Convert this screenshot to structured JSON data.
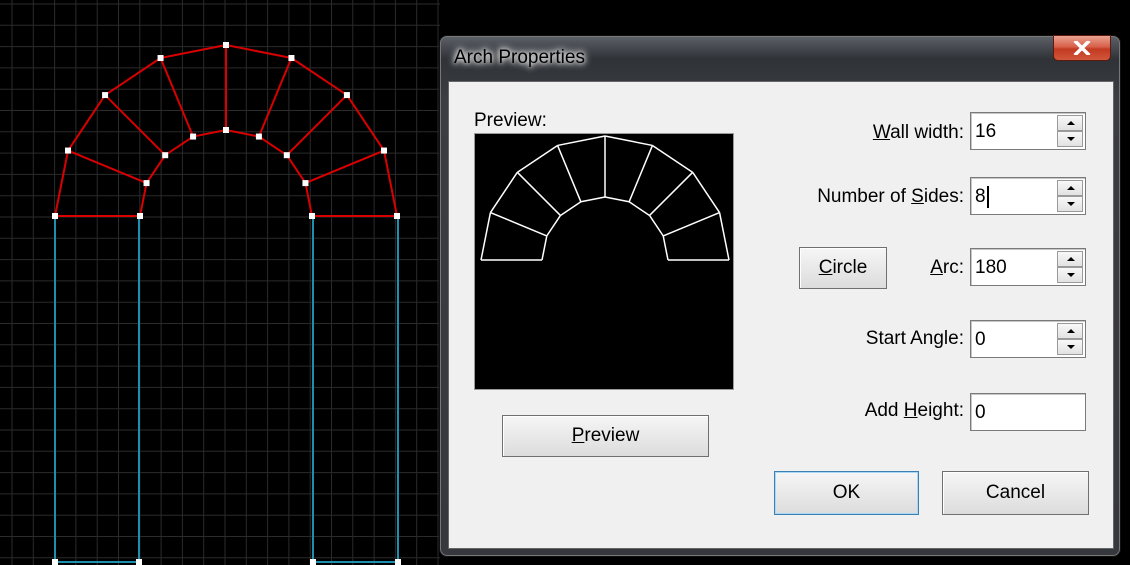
{
  "dialog": {
    "title": "Arch Properties",
    "close_glyph": "x",
    "preview_label": "Preview:",
    "preview_button": "Preview",
    "ok_button": "OK",
    "cancel_button": "Cancel",
    "circle_button": "Circle",
    "fields": {
      "wall_width": {
        "label": "Wall width:",
        "value": "16"
      },
      "number_of_sides": {
        "label": "Number of Sides:",
        "value": "8"
      },
      "arc": {
        "label": "Arc:",
        "value": "180"
      },
      "start_angle": {
        "label": "Start Angle:",
        "value": "0"
      },
      "add_height": {
        "label": "Add Height:",
        "value": "0"
      }
    }
  },
  "colors": {
    "grid": "#2b2b2b",
    "arch_lines": "#d80000",
    "wall_lines": "#1e8fb0",
    "vertices": "#ffffff",
    "preview_lines": "#ffffff"
  },
  "icons": {
    "close": "close-x-icon",
    "spin_up": "arrow-up-icon",
    "spin_down": "arrow-down-icon"
  }
}
